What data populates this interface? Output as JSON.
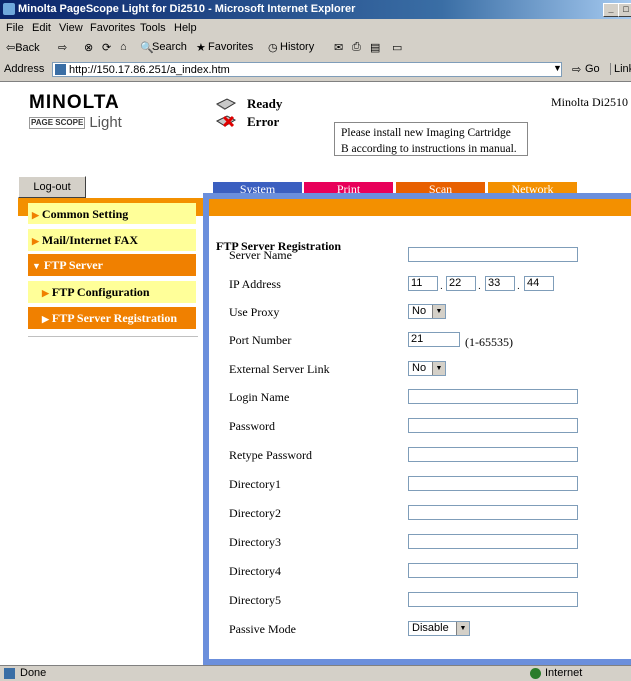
{
  "window": {
    "title": "Minolta PageScope Light for Di2510 - Microsoft Internet Explorer",
    "min_glyph": "_",
    "max_glyph": "□"
  },
  "menu": [
    "File",
    "Edit",
    "View",
    "Favorites",
    "Tools",
    "Help"
  ],
  "toolbar": {
    "back": "⇦Back",
    "forward": "⇨",
    "search": "Search",
    "favorites": "Favorites",
    "history": "History"
  },
  "address": {
    "label": "Address",
    "url": "http://150.17.86.251/a_index.htm",
    "go": "Go",
    "links": "Links"
  },
  "header": {
    "brand": "MINOLTA",
    "pagescope_badge": "PAGE SCOPE",
    "pagescope": "Light",
    "ready": "Ready",
    "error": "Error",
    "message": "Please install new Imaging Cartridge B according to instructions in manual.",
    "model": "Minolta Di2510"
  },
  "logout": "Log-out",
  "tabs": [
    {
      "label": "System",
      "color": "#3b5fc0"
    },
    {
      "label": "Print",
      "color": "#e8005a"
    },
    {
      "label": "Scan",
      "color": "#e86000"
    },
    {
      "label": "Network",
      "color": "#f39000"
    }
  ],
  "sidebar": [
    {
      "label": "Common Setting",
      "style": "yellow"
    },
    {
      "label": "Mail/Internet FAX",
      "style": "yellow"
    },
    {
      "label": "FTP Server",
      "style": "orange-open"
    },
    {
      "label": "FTP Configuration",
      "style": "yellow-sub"
    },
    {
      "label": "FTP Server Registration",
      "style": "orange-sub"
    }
  ],
  "form": {
    "title": "FTP Server Registration",
    "server_name": {
      "label": "Server Name",
      "value": ""
    },
    "ip_address": {
      "label": "IP Address",
      "values": [
        "11",
        "22",
        "33",
        "44"
      ]
    },
    "use_proxy": {
      "label": "Use Proxy",
      "value": "No"
    },
    "port_number": {
      "label": "Port Number",
      "value": "21",
      "hint": "(1-65535)"
    },
    "external_server_link": {
      "label": "External Server Link",
      "value": "No"
    },
    "login_name": {
      "label": "Login Name",
      "value": ""
    },
    "password": {
      "label": "Password",
      "value": ""
    },
    "retype_password": {
      "label": "Retype Password",
      "value": ""
    },
    "directory1": {
      "label": "Directory1",
      "value": ""
    },
    "directory2": {
      "label": "Directory2",
      "value": ""
    },
    "directory3": {
      "label": "Directory3",
      "value": ""
    },
    "directory4": {
      "label": "Directory4",
      "value": ""
    },
    "directory5": {
      "label": "Directory5",
      "value": ""
    },
    "passive_mode": {
      "label": "Passive Mode",
      "value": "Disable"
    }
  },
  "statusbar": {
    "left": "Done",
    "zone": "Internet"
  },
  "colors": {
    "accent_orange": "#f39000",
    "frame_blue": "#6b8fdc",
    "nav_yellow": "#ffff99"
  }
}
